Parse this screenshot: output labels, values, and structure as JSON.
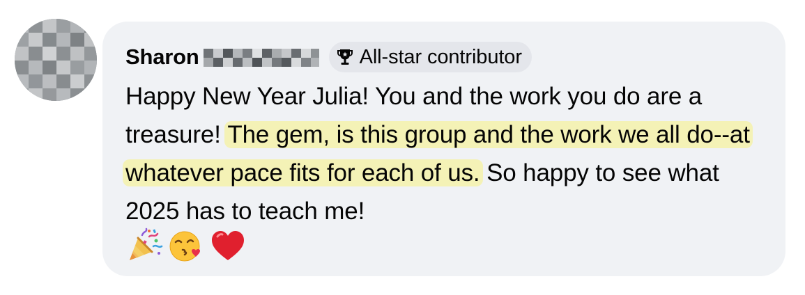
{
  "comment": {
    "author_name": "Sharon",
    "badge": {
      "label": "All-star contributor",
      "icon": "trophy-icon"
    },
    "text_before_highlight": "Happy New Year Julia! You and the work you do are a treasure! ",
    "highlighted_text": "The gem, is this group and the work we all do--at whatever pace fits for each of us.",
    "text_after_highlight": " So happy to see what 2025 has to teach me!",
    "emojis": [
      "party-popper",
      "face-blowing-a-kiss",
      "red-heart"
    ]
  },
  "colors": {
    "bubble_background": "#f0f2f5",
    "badge_background": "#e4e6eb",
    "text": "#050505",
    "highlight": "#f5f1a0"
  }
}
